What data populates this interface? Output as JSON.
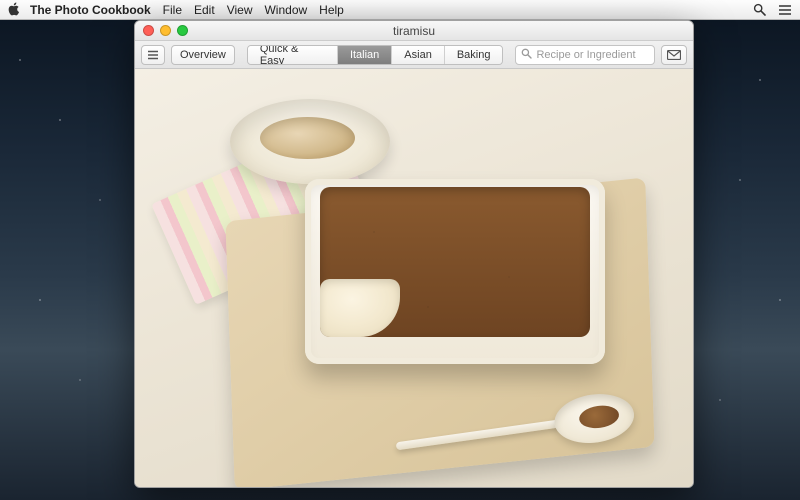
{
  "menubar": {
    "app_name": "The Photo Cookbook",
    "items": [
      "File",
      "Edit",
      "View",
      "Window",
      "Help"
    ]
  },
  "window": {
    "title": "tiramisu"
  },
  "toolbar": {
    "overview_label": "Overview",
    "tabs": [
      {
        "label": "Quick & Easy",
        "active": false
      },
      {
        "label": "Italian",
        "active": true
      },
      {
        "label": "Asian",
        "active": false
      },
      {
        "label": "Baking",
        "active": false
      }
    ],
    "search_placeholder": "Recipe or Ingredient"
  },
  "icons": {
    "apple": "apple-logo",
    "spotlight": "search-icon",
    "menu_extra": "menu-icon",
    "hamburger": "list-icon",
    "mail": "mail-icon",
    "search_glyph": "magnifier-icon"
  }
}
